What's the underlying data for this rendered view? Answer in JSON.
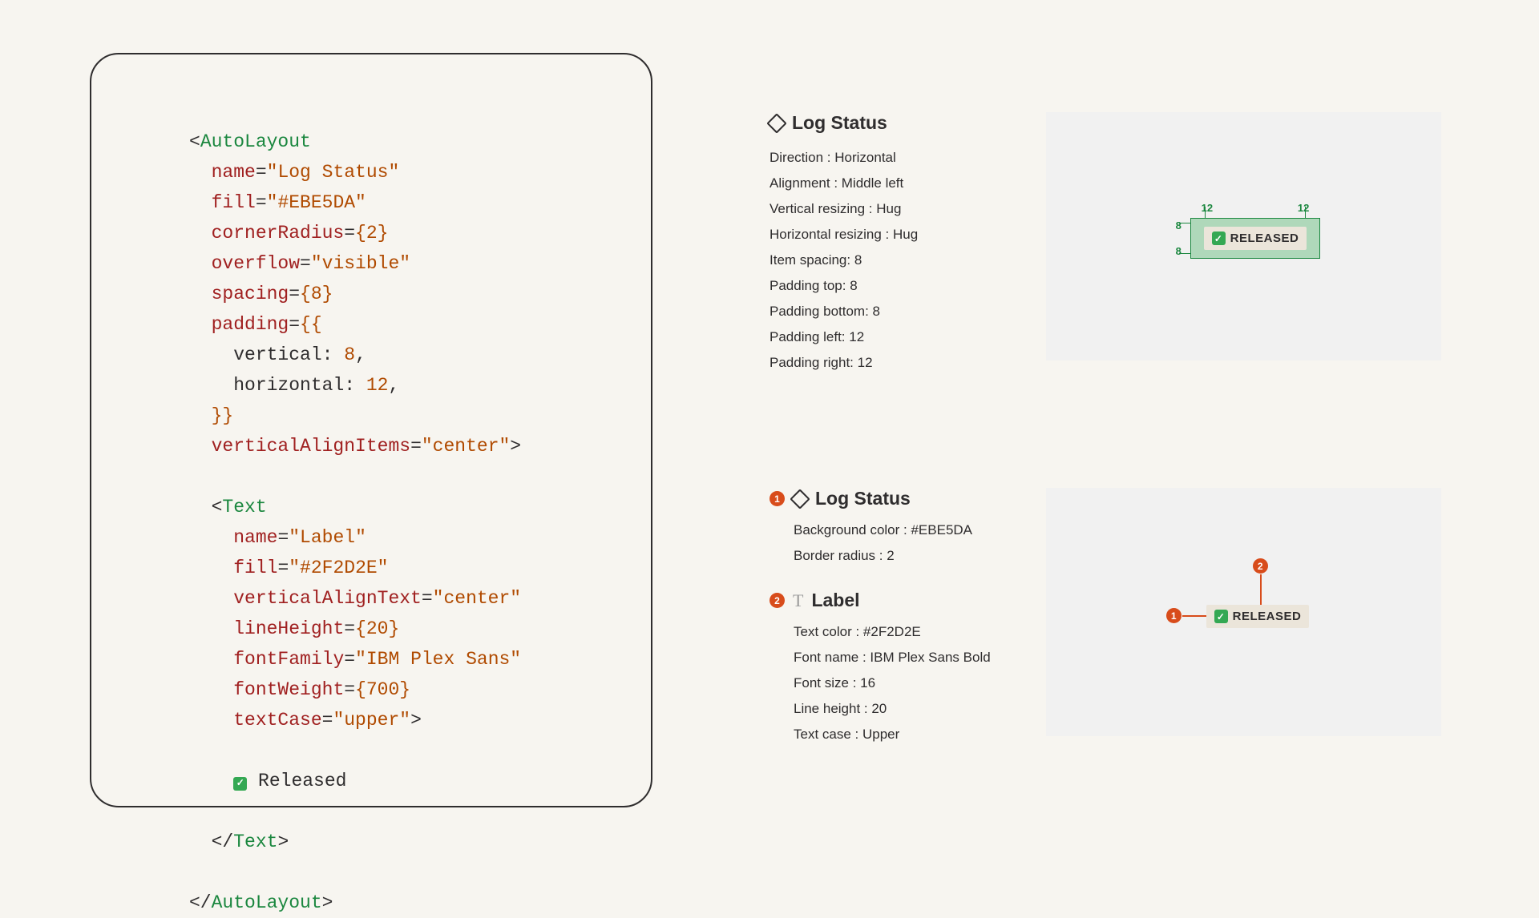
{
  "code": {
    "tag_open": "AutoLayout",
    "attr_name": "name",
    "val_name": "\"Log Status\"",
    "attr_fill": "fill",
    "val_fill": "\"#EBE5DA\"",
    "attr_corner": "cornerRadius",
    "val_corner": "{2}",
    "attr_overflow": "overflow",
    "val_overflow": "\"visible\"",
    "attr_spacing": "spacing",
    "val_spacing": "{8}",
    "attr_padding": "padding",
    "val_padding_open": "{{",
    "pad_v_key": "vertical: ",
    "pad_v_val": "8",
    "pad_h_key": "horizontal: ",
    "pad_h_val": "12",
    "val_padding_close": "}}",
    "attr_valign": "verticalAlignItems",
    "val_valign": "\"center\"",
    "tag_text": "Text",
    "t_attr_name": "name",
    "t_val_name": "\"Label\"",
    "t_attr_fill": "fill",
    "t_val_fill": "\"#2F2D2E\"",
    "t_attr_vat": "verticalAlignText",
    "t_val_vat": "\"center\"",
    "t_attr_lh": "lineHeight",
    "t_val_lh": "{20}",
    "t_attr_ff": "fontFamily",
    "t_val_ff": "\"IBM Plex Sans\"",
    "t_attr_fw": "fontWeight",
    "t_val_fw": "{700}",
    "t_attr_tc": "textCase",
    "t_val_tc": "\"upper\"",
    "t_body": "Released"
  },
  "section1": {
    "title": "Log Status",
    "rows": {
      "r0": "Direction : Horizontal",
      "r1": "Alignment : Middle left",
      "r2": "Vertical resizing : Hug",
      "r3": "Horizontal resizing : Hug",
      "r4": "Item spacing: 8",
      "r5": "Padding top: 8",
      "r6": "Padding bottom: 8",
      "r7": "Padding left: 12",
      "r8": "Padding right: 12"
    },
    "pad": {
      "v": "8",
      "h": "12"
    },
    "tagText": "RELEASED"
  },
  "section2": {
    "b1": {
      "num": "1",
      "title": "Log Status",
      "rows": {
        "r0": "Background color : #EBE5DA",
        "r1": "Border radius : 2"
      }
    },
    "b2": {
      "num": "2",
      "title": "Label",
      "rows": {
        "r0": "Text color : #2F2D2E",
        "r1": "Font name : IBM Plex Sans Bold",
        "r2": "Font size : 16",
        "r3": "Line height : 20",
        "r4": "Text case : Upper"
      }
    },
    "tagText": "RELEASED",
    "callout1": "1",
    "callout2": "2"
  }
}
